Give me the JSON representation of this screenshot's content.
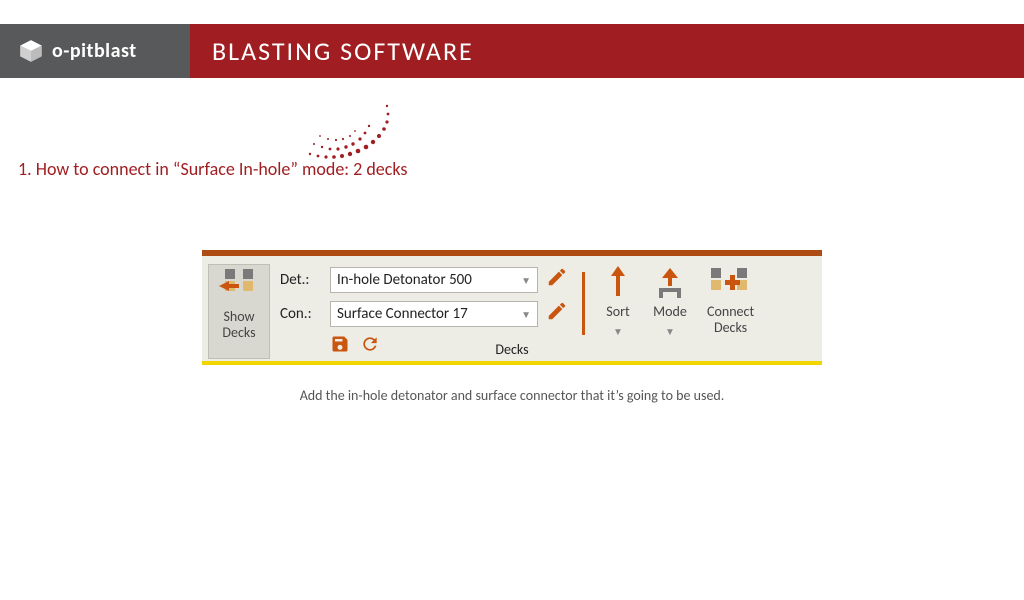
{
  "header": {
    "brand": "o-pitblast",
    "title": "BLASTING SOFTWARE"
  },
  "heading": "1. How to connect in “Surface In-hole” mode: 2 decks",
  "ribbon": {
    "show_decks_label": "Show\nDecks",
    "det_label": "Det.:",
    "det_value": "In-hole Detonator 500",
    "con_label": "Con.:",
    "con_value": "Surface Connector 17",
    "sort_label": "Sort",
    "mode_label": "Mode",
    "connect_decks_label": "Connect\nDecks",
    "group_label": "Decks"
  },
  "caption": "Add the in-hole detonator and surface connector that it’s going to be used."
}
